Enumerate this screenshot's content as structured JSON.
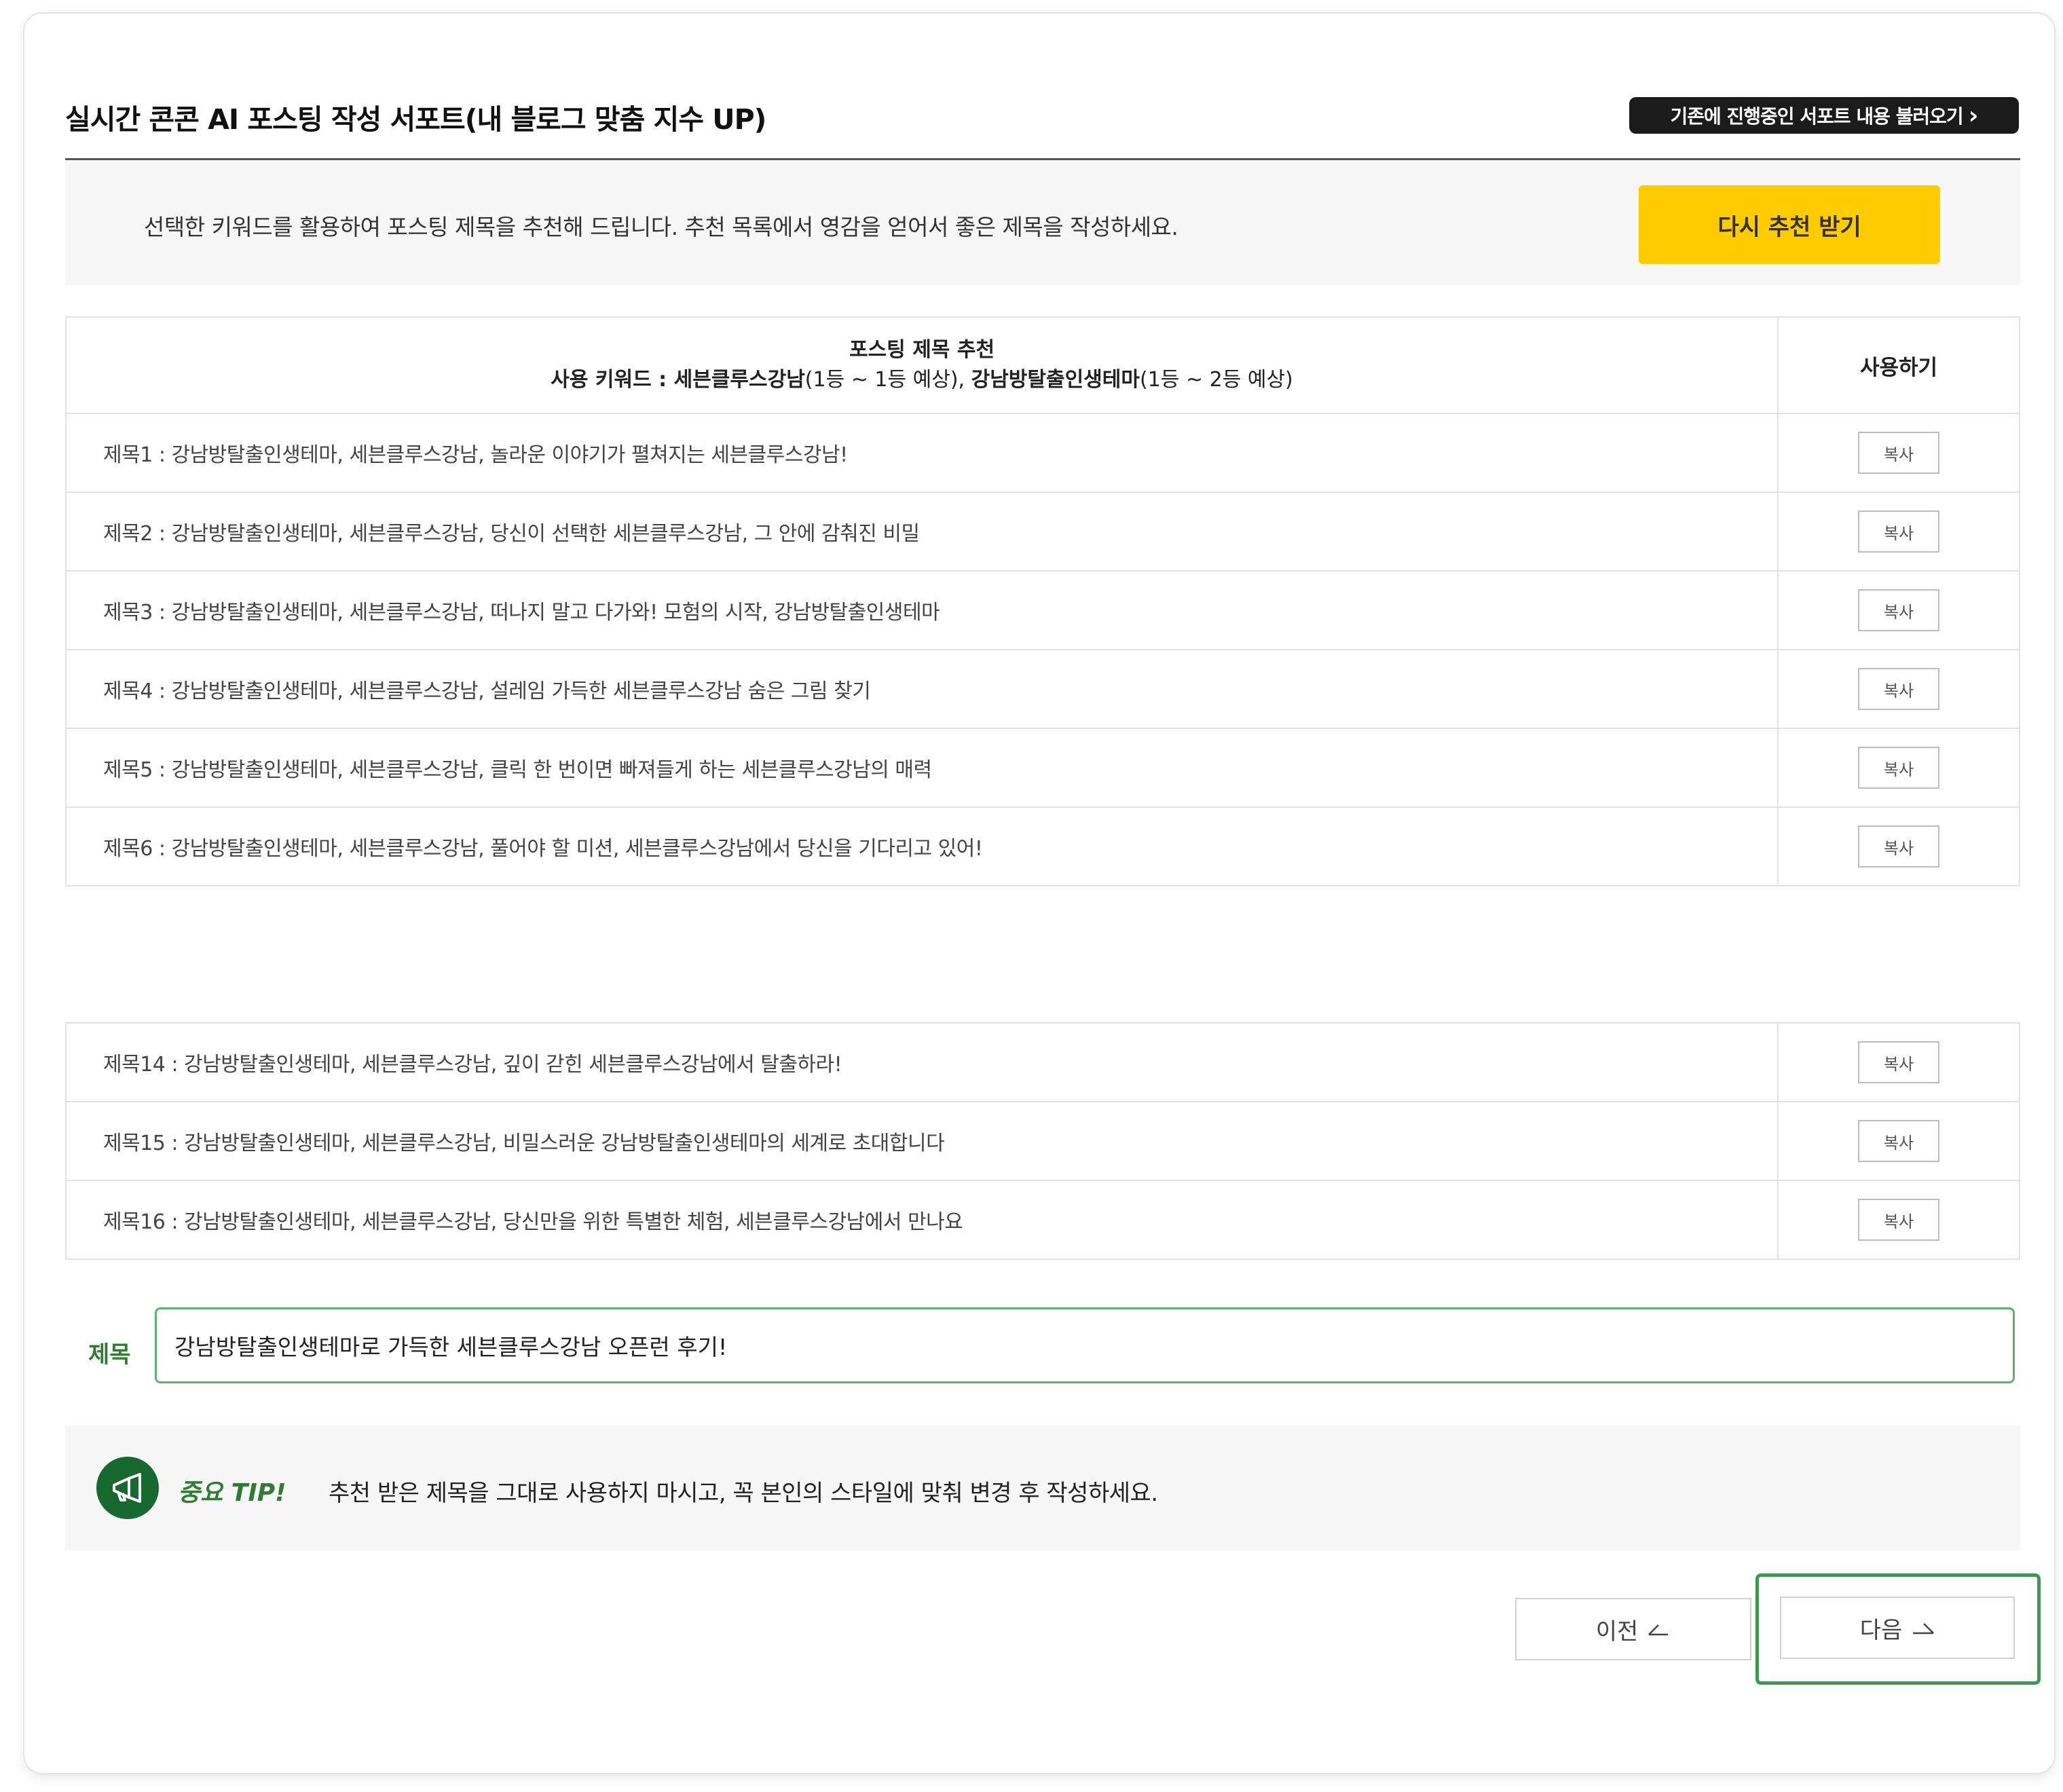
{
  "header": {
    "title": "실시간 콘콘 AI 포스팅 작성 서포트(내 블로그 맞춤 지수 UP)",
    "load_button": "기존에 진행중인 서포트 내용 불러오기",
    "load_button_arrow": "›"
  },
  "info": {
    "text": "선택한 키워드를 활용하여 포스팅 제목을 추천해 드립니다. 추천 목록에서 영감을 얻어서 좋은 제목을 작성하세요.",
    "regenerate_button": "다시 추천 받기"
  },
  "table": {
    "heading": "포스팅 제목 추천",
    "keywords_label": "사용 키워드 : ",
    "keyword1": "세븐클루스강남",
    "keyword1_rank": "(1등 ~ 1등 예상), ",
    "keyword2": "강남방탈출인생테마",
    "keyword2_rank": "(1등 ~ 2등 예상)",
    "use_header": "사용하기",
    "copy_label": "복사",
    "rows_a": [
      "제목1 : 강남방탈출인생테마, 세븐클루스강남, 놀라운 이야기가 펼쳐지는 세븐클루스강남!",
      "제목2 : 강남방탈출인생테마, 세븐클루스강남, 당신이 선택한 세븐클루스강남, 그 안에 감춰진 비밀",
      "제목3 : 강남방탈출인생테마, 세븐클루스강남, 떠나지 말고 다가와! 모험의 시작, 강남방탈출인생테마",
      "제목4 : 강남방탈출인생테마, 세븐클루스강남, 설레임 가득한 세븐클루스강남 숨은 그림 찾기",
      "제목5 : 강남방탈출인생테마, 세븐클루스강남, 클릭 한 번이면 빠져들게 하는 세븐클루스강남의 매력",
      "제목6 : 강남방탈출인생테마, 세븐클루스강남, 풀어야 할 미션, 세븐클루스강남에서 당신을 기다리고 있어!"
    ],
    "rows_b": [
      "제목14 : 강남방탈출인생테마, 세븐클루스강남, 깊이 갇힌 세븐클루스강남에서 탈출하라!",
      "제목15 : 강남방탈출인생테마, 세븐클루스강남, 비밀스러운 강남방탈출인생테마의 세계로 초대합니다",
      "제목16 : 강남방탈출인생테마, 세븐클루스강남, 당신만을 위한 특별한 체험, 세븐클루스강남에서 만나요"
    ]
  },
  "subject": {
    "label": "제목",
    "value": "강남방탈출인생테마로 가득한 세븐클루스강남 오픈런 후기!"
  },
  "tip": {
    "label": "중요 TIP!",
    "text": "추천 받은 제목을 그대로 사용하지 마시고, 꼭 본인의 스타일에 맞춰 변경 후 작성하세요."
  },
  "nav": {
    "prev": "이전",
    "next": "다음"
  },
  "colors": {
    "accent_yellow": "#ffcc00",
    "accent_green": "#2e7d32",
    "dark_button": "#1b1b1b"
  },
  "icons": {
    "tip": "megaphone-icon",
    "prev": "arrow-left-icon",
    "next": "arrow-right-icon"
  }
}
